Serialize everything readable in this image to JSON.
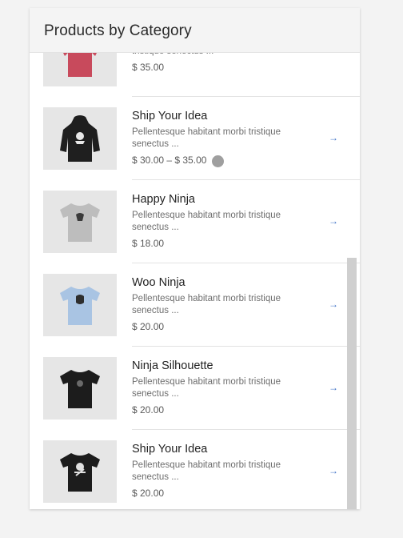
{
  "header": {
    "title": "Products by Category"
  },
  "products": [
    {
      "name": "",
      "desc": "tristique senectus ...",
      "price": "$ 35.00",
      "icon": "red-hoodie-thumbnail",
      "color": "#c84a5c"
    },
    {
      "name": "Ship Your Idea",
      "desc": "Pellentesque habitant morbi tristique senectus ...",
      "price": "$ 30.00 – $ 35.00",
      "icon": "black-hoodie-thumbnail",
      "color": "#1f1f1f"
    },
    {
      "name": "Happy Ninja",
      "desc": "Pellentesque habitant morbi tristique senectus ...",
      "price": "$ 18.00",
      "icon": "gray-tshirt-thumbnail",
      "color": "#bdbdbd"
    },
    {
      "name": "Woo Ninja",
      "desc": "Pellentesque habitant morbi tristique senectus ...",
      "price": "$ 20.00",
      "icon": "light-blue-tshirt-thumbnail",
      "color": "#a9c4e3"
    },
    {
      "name": "Ninja Silhouette",
      "desc": "Pellentesque habitant morbi tristique senectus ...",
      "price": "$ 20.00",
      "icon": "black-tshirt-thumbnail",
      "color": "#1c1c1c"
    },
    {
      "name": "Ship Your Idea",
      "desc": "Pellentesque habitant morbi tristique senectus ...",
      "price": "$ 20.00",
      "icon": "black-tshirt-thumbnail",
      "color": "#1c1c1c"
    }
  ],
  "arrow_icon": "→",
  "colors": {
    "arrow": "#3b6fc5",
    "header_bg": "#f4f4f4",
    "thumb_bg": "#e6e6e6"
  }
}
